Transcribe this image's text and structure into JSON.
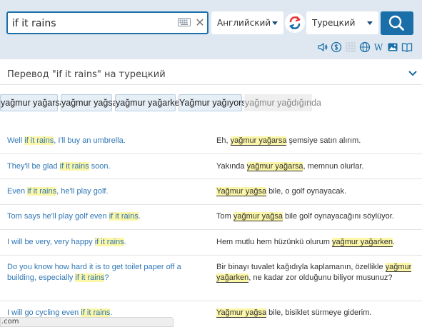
{
  "search": {
    "value": "if it rains"
  },
  "languages": {
    "source": "Английский",
    "target": "Турецкий"
  },
  "toolbar": {
    "icons": [
      "speaker-icon",
      "dollar-circle-icon",
      "grid-icon",
      "globe-icon",
      "wikipedia-icon",
      "image-icon",
      "book-icon"
    ],
    "wikipedia_glyph": "W"
  },
  "result": {
    "title": "Перевод \"if it rains\" на турецкий"
  },
  "chips": [
    {
      "label": "yağmur yağarsa"
    },
    {
      "label": "yağmur yağsa"
    },
    {
      "label": "yağmur yağarken"
    },
    {
      "label": "Yağmur yağıyorsa"
    },
    {
      "label": "yağmur yağdığında"
    }
  ],
  "examples": [
    {
      "src": {
        "pre": "Well ",
        "hl": "if it rains",
        "post": ", I'll buy an umbrella."
      },
      "dst": {
        "pre": "Eh, ",
        "hl": "yağmur yağarsa",
        "post": " şemsiye satın alırım."
      }
    },
    {
      "src": {
        "pre": "They'll be glad ",
        "hl": "if it rains",
        "post": " soon."
      },
      "dst": {
        "pre": "Yakında ",
        "hl": "yağmur yağarsa",
        "post": ", memnun olurlar."
      }
    },
    {
      "src": {
        "pre": "Even ",
        "hl": "if it rains",
        "post": ", he'll play golf."
      },
      "dst": {
        "pre": "",
        "hl": "Yağmur yağsa",
        "post": " bile, o golf oynayacak."
      }
    },
    {
      "src": {
        "pre": "Tom says he'll play golf even ",
        "hl": "if it rains",
        "post": "."
      },
      "dst": {
        "pre": "Tom ",
        "hl": "yağmur yağsa",
        "post": " bile golf oynayacağını söylüyor."
      }
    },
    {
      "src": {
        "pre": "I will be very, very happy ",
        "hl": "if it rains",
        "post": "."
      },
      "dst": {
        "pre": "Hem mutlu hem hüzünkü olurum ",
        "hl": "yağmur yağarken",
        "post": "."
      }
    },
    {
      "src": {
        "pre": "Do you know how hard it is to get toilet paper off a building, especially ",
        "hl": "if it rains",
        "post": "?"
      },
      "dst": {
        "pre": "Bir binayı tuvalet kağıdıyla kaplamanın, özellikle ",
        "hl": "yağmur yağarken",
        "post": ", ne kadar zor olduğunu biliyor musunuz?"
      }
    },
    {
      "src": {
        "pre": "I will go cycling even ",
        "hl": "if it rains",
        "post": "."
      },
      "dst": {
        "pre": "",
        "hl": "Yağmur yağsa",
        "post": " bile, bisiklet sürmeye giderim."
      }
    }
  ],
  "status_bar": {
    "text": ".com"
  },
  "colors": {
    "accent": "#1b6fa8",
    "link": "#2f76b5",
    "highlight": "#fbf6a8",
    "swap_red": "#e8363a"
  }
}
